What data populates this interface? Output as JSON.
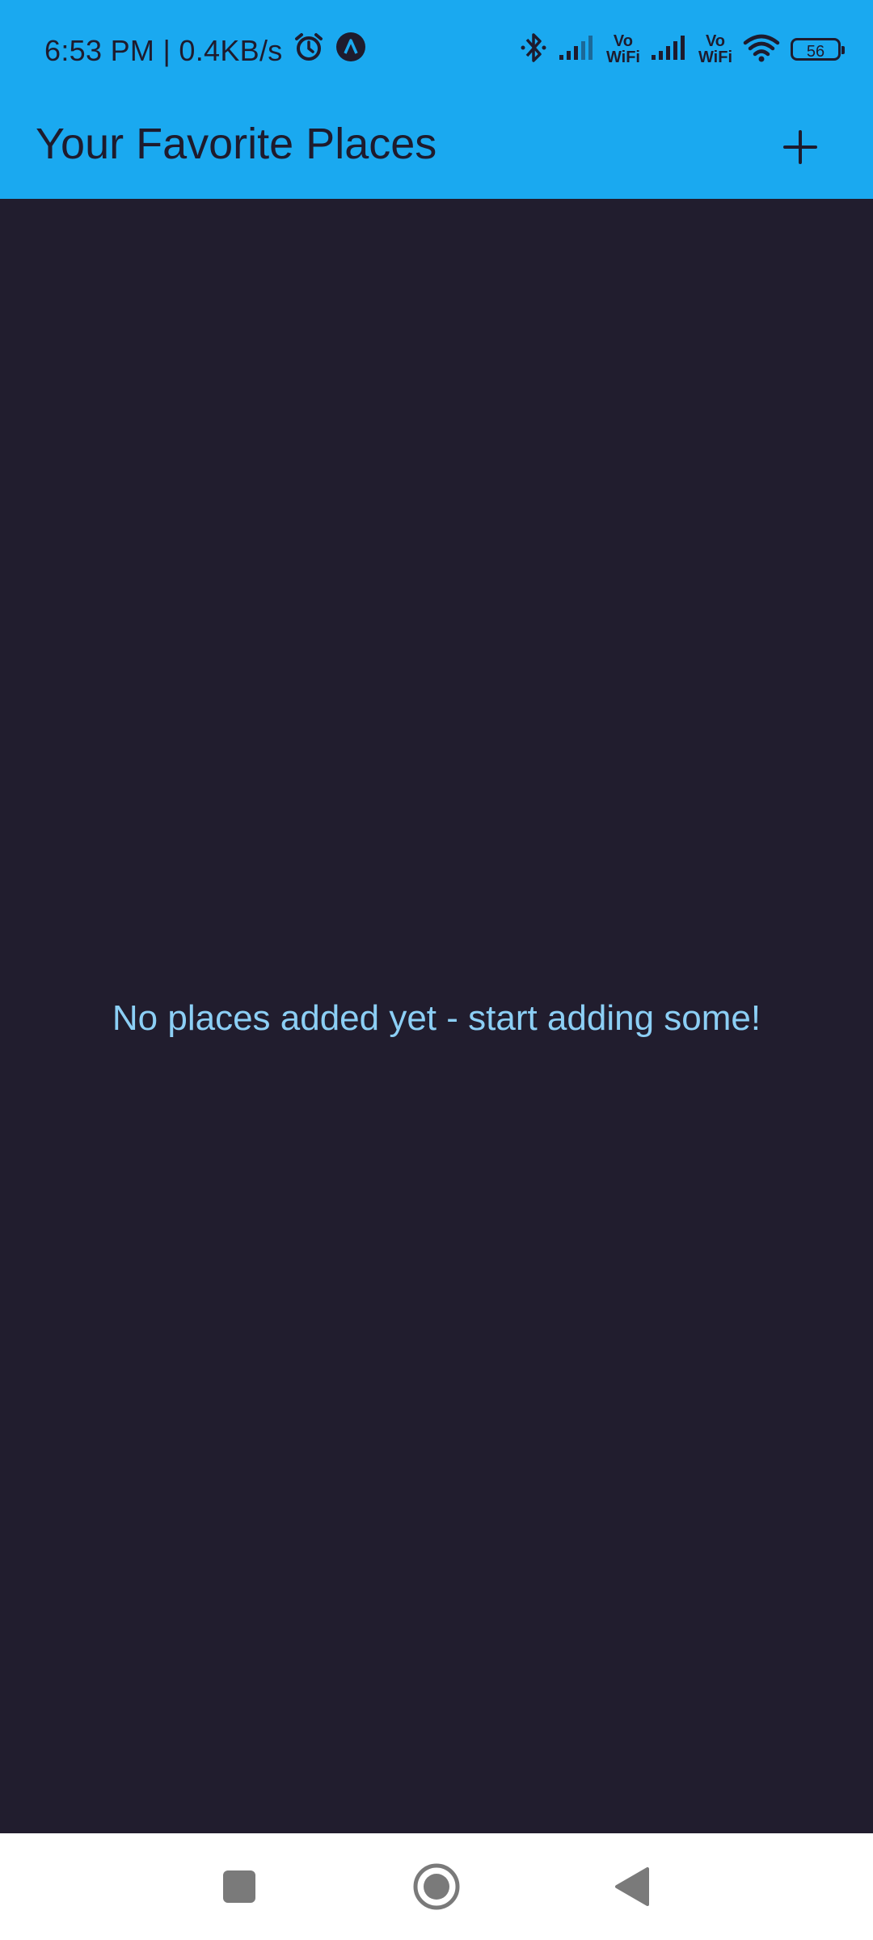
{
  "status_bar": {
    "time": "6:53 PM | 0.4KB/s",
    "sim1_label_top": "Vo",
    "sim1_label_bottom": "WiFi",
    "sim2_label_top": "Vo",
    "sim2_label_bottom": "WiFi",
    "battery": "56",
    "icons": [
      "alarm-icon",
      "app-notification-icon",
      "bluetooth-icon",
      "signal-icon",
      "signal-icon",
      "wifi-icon",
      "battery-icon"
    ]
  },
  "app_bar": {
    "title": "Your Favorite Places",
    "add_icon": "plus-icon"
  },
  "main": {
    "empty_message": "No places added yet - start adding some!"
  },
  "nav_bar": {
    "buttons": [
      "recents-icon",
      "home-icon",
      "back-icon"
    ]
  },
  "colors": {
    "primary": "#1aa9f0",
    "background": "#211d2e",
    "message": "#8ccff5",
    "on_primary": "#1e1b2d"
  }
}
